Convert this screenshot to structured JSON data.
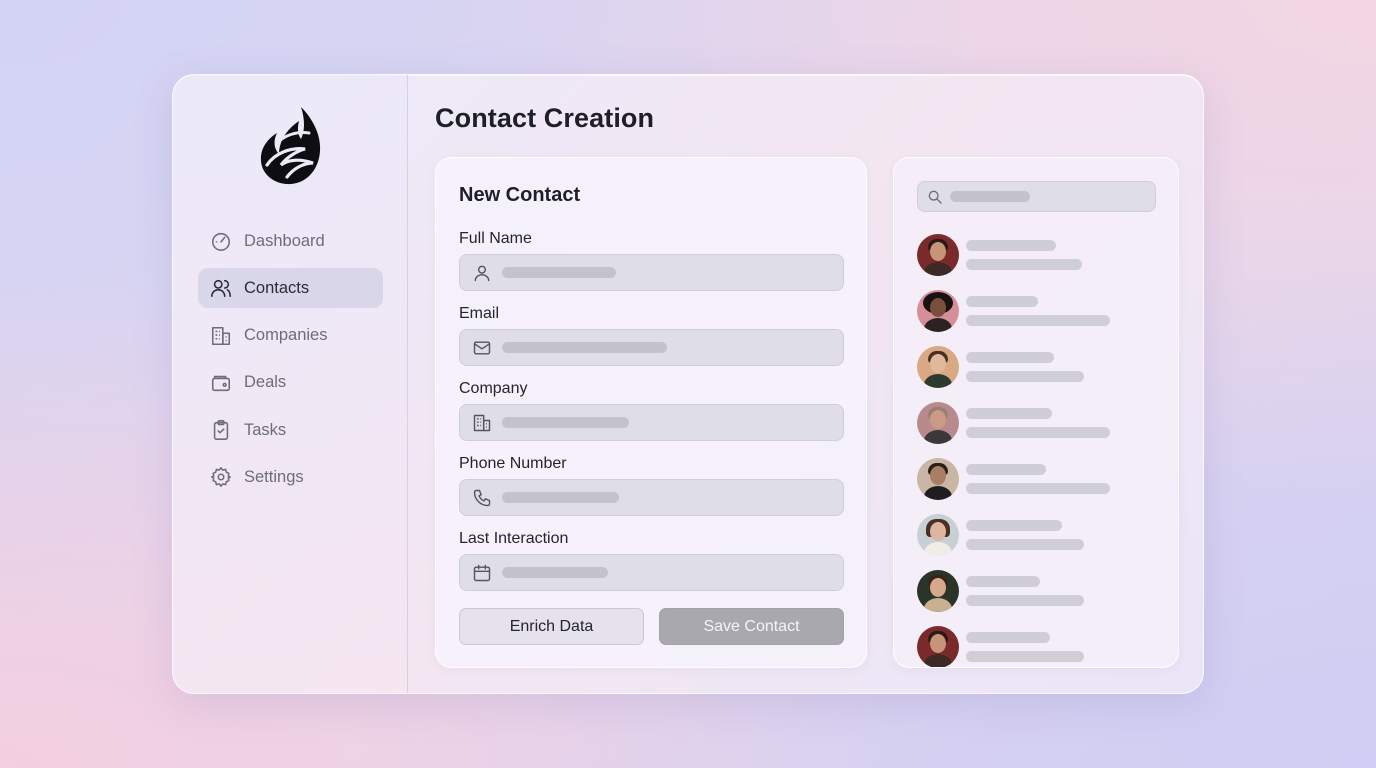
{
  "sidebar": {
    "logo": "flame-logo",
    "items": [
      {
        "label": "Dashboard",
        "icon": "gauge-icon",
        "active": false
      },
      {
        "label": "Contacts",
        "icon": "users-icon",
        "active": true
      },
      {
        "label": "Companies",
        "icon": "building-icon",
        "active": false
      },
      {
        "label": "Deals",
        "icon": "wallet-icon",
        "active": false
      },
      {
        "label": "Tasks",
        "icon": "clipboard-check-icon",
        "active": false
      },
      {
        "label": "Settings",
        "icon": "gear-icon",
        "active": false
      }
    ]
  },
  "main": {
    "title": "Contact Creation"
  },
  "form": {
    "title": "New Contact",
    "fields": [
      {
        "label": "Full Name",
        "icon": "user-icon",
        "value": ""
      },
      {
        "label": "Email",
        "icon": "mail-icon",
        "value": ""
      },
      {
        "label": "Company",
        "icon": "building-icon",
        "value": ""
      },
      {
        "label": "Phone Number",
        "icon": "phone-icon",
        "value": ""
      },
      {
        "label": "Last Interaction",
        "icon": "calendar-icon",
        "value": ""
      }
    ],
    "enrich_label": "Enrich Data",
    "save_label": "Save Contact"
  },
  "contacts": {
    "search_icon": "search-icon",
    "count": 8
  },
  "colors": {
    "accent_active": "#d2d0e6",
    "save_button": "#a9a8ae",
    "text_primary": "#1f1f27"
  }
}
